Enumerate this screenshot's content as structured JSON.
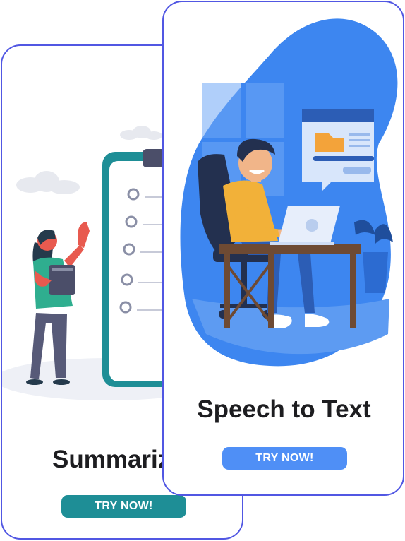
{
  "cards": {
    "summarize": {
      "title": "Summarize",
      "button_label": "TRY NOW!",
      "accent_color": "#1e8e96",
      "icon": "checklist-clipboard-illustration"
    },
    "speech_to_text": {
      "title": "Speech to Text",
      "button_label": "TRY NOW!",
      "accent_color": "#4f8ff6",
      "icon": "man-at-laptop-illustration"
    }
  },
  "colors": {
    "card_border": "#5157e3",
    "title_text": "#1d1d20"
  }
}
